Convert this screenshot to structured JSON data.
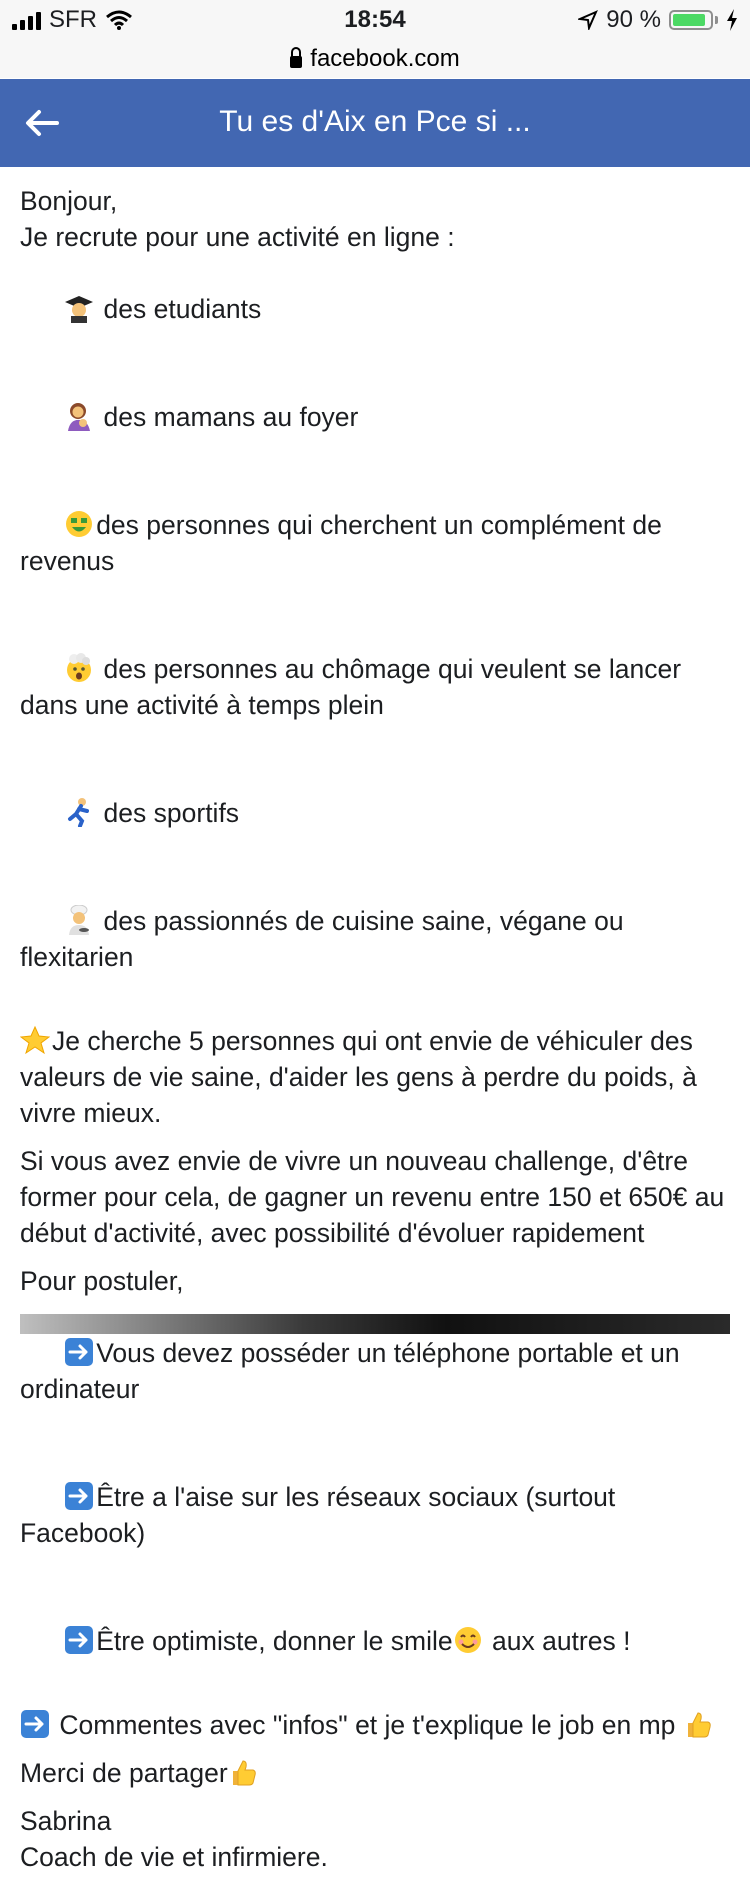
{
  "status": {
    "carrier": "SFR",
    "time": "18:54",
    "battery": "90 %",
    "battery_level": 0.9
  },
  "browser": {
    "url": "facebook.com"
  },
  "navbar": {
    "title": "Tu es d'Aix en Pce si ..."
  },
  "post": {
    "p1": [
      "Bonjour,",
      "Je recrute pour une activité en ligne :",
      " des etudiants",
      " des mamans au foyer",
      "des personnes qui cherchent un complément de revenus",
      " des personnes au chômage qui veulent se lancer dans une activité à temps plein",
      " des sportifs",
      " des passionnés de cuisine saine, végane ou flexitarien"
    ],
    "p2": "Je cherche 5 personnes qui ont envie de véhiculer des valeurs de vie saine, d'aider les gens à perdre du poids, à vivre mieux.",
    "p3": "Si vous avez envie de vivre un nouveau challenge, d'être former pour cela, de gagner un revenu entre 150 et 650€ au début d'activité, avec possibilité d'évoluer rapidement",
    "p4": [
      "Pour postuler,",
      "Vous devez posséder un téléphone portable et un ordinateur",
      "Être a l'aise sur les réseaux sociaux (surtout Facebook)",
      "Être optimiste, donner le smile",
      " aux autres !"
    ],
    "p5": " Commentes avec \"infos\" et je t'explique le job en mp ",
    "p6": "Merci de partager",
    "p7": [
      "Sabrina",
      "Coach de vie et infirmiere."
    ]
  },
  "icons": {
    "graduate": "student-emoji-icon",
    "mother": "mother-baby-emoji-icon",
    "money": "money-mouth-emoji-icon",
    "explode": "exploding-head-emoji-icon",
    "sport": "athlete-emoji-icon",
    "cook": "cook-emoji-icon",
    "star": "star-emoji-icon",
    "arrow": "right-arrow-emoji-icon",
    "smile": "smiling-emoji-icon",
    "thumb": "thumbs-up-emoji-icon"
  }
}
